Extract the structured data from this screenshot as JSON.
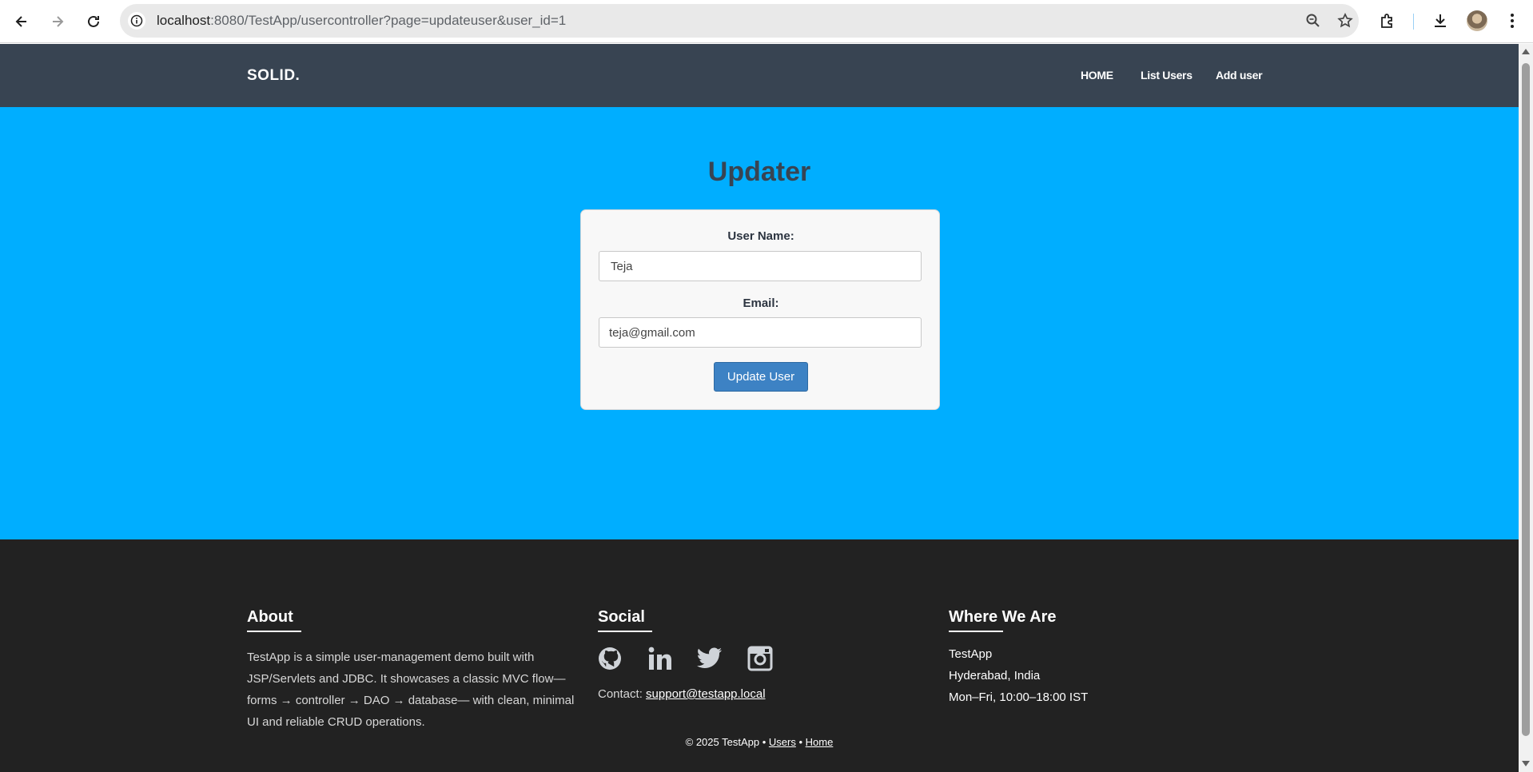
{
  "browser": {
    "url_host": "localhost",
    "url_rest": ":8080/TestApp/usercontroller?page=updateuser&user_id=1"
  },
  "navbar": {
    "brand": "SOLID.",
    "items": [
      {
        "label": "HOME"
      },
      {
        "label": "List Users"
      },
      {
        "label": "Add user"
      }
    ]
  },
  "hero": {
    "title": "Updater",
    "form": {
      "username_label": "User Name:",
      "username_value": "Teja",
      "email_label": "Email:",
      "email_value": "teja@gmail.com",
      "submit_label": "Update User"
    }
  },
  "footer": {
    "about": {
      "heading": "About",
      "text": "TestApp is a simple user-management demo built with JSP/Servlets and JDBC. It showcases a classic MVC flow—forms → controller → DAO → database— with clean, minimal UI and reliable CRUD operations."
    },
    "social": {
      "heading": "Social",
      "icons": [
        "github-icon",
        "linkedin-icon",
        "twitter-icon",
        "instagram-icon"
      ],
      "contact_label": "Contact:",
      "contact_email": "support@testapp.local"
    },
    "where": {
      "heading": "Where We Are",
      "line1": "TestApp",
      "line2": "Hyderabad, India",
      "line3": "Mon–Fri, 10:00–18:00 IST"
    },
    "copyright": "© 2025 TestApp •",
    "links": [
      "Users",
      "Home"
    ],
    "separator": "•"
  },
  "colors": {
    "navbar_bg": "#384452",
    "hero_bg": "#00aeff",
    "footer_bg": "#222222",
    "button_bg": "#3d82c4"
  }
}
